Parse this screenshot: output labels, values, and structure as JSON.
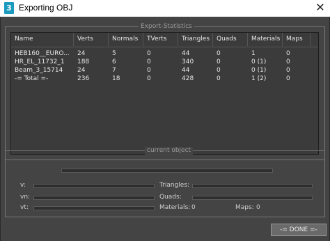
{
  "window": {
    "title": "Exporting OBJ",
    "app_icon_text": "3",
    "close_glyph": "✕"
  },
  "stats": {
    "legend": "Export-Statistics",
    "columns": [
      "Name",
      "Verts",
      "Normals",
      "TVerts",
      "Triangles",
      "Quads",
      "Materials",
      "Maps"
    ],
    "rows": [
      [
        "HEB160__EURO...",
        "24",
        "5",
        "0",
        "44",
        "0",
        "1",
        "0"
      ],
      [
        "HR_EL_11732_1",
        "188",
        "6",
        "0",
        "340",
        "0",
        "0 (1)",
        "0"
      ],
      [
        "Beam_3_15714",
        "24",
        "7",
        "0",
        "44",
        "0",
        "0 (1)",
        "0"
      ],
      [
        "-= Total =-",
        "236",
        "18",
        "0",
        "428",
        "0",
        "1 (2)",
        "0"
      ]
    ]
  },
  "current_object": {
    "legend": "current object",
    "v_label": "v:",
    "vn_label": "vn:",
    "vt_label": "vt:",
    "triangles_label": "Triangles:",
    "quads_label": "Quads:",
    "materials_label": "Materials:",
    "materials_value": "0",
    "maps_label": "Maps:",
    "maps_value": "0"
  },
  "done_button": "-= DONE =-"
}
